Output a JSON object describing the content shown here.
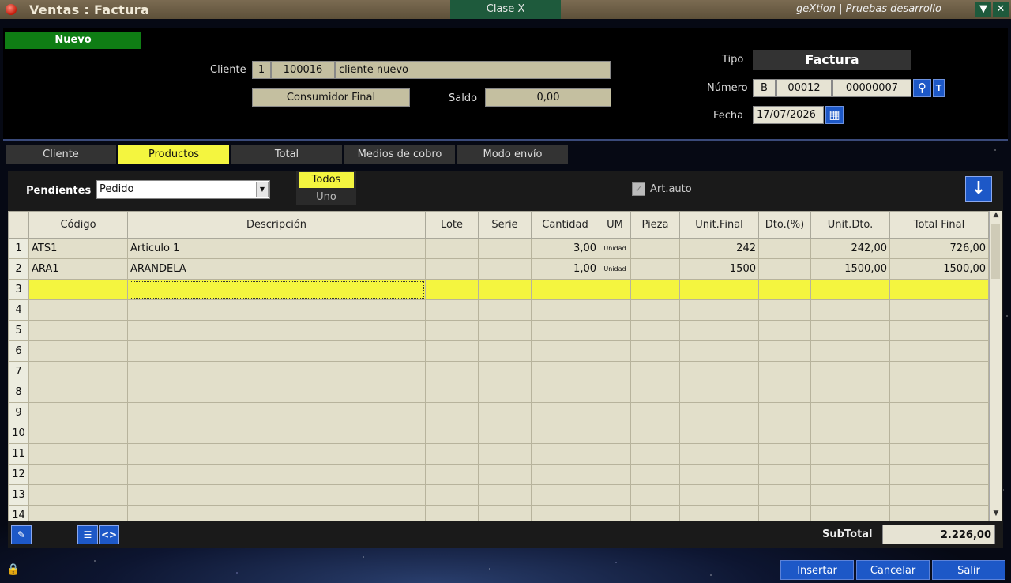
{
  "window": {
    "title": "Ventas : Factura",
    "clase": "Clase X",
    "app_name": "geXtion | Pruebas desarrollo",
    "min_glyph": "▼",
    "close_glyph": "✕"
  },
  "header": {
    "status": "Nuevo",
    "cliente_label": "Cliente",
    "cliente_num": "1",
    "cliente_code": "100016",
    "cliente_name": "cliente nuevo",
    "condicion": "Consumidor Final",
    "saldo_label": "Saldo",
    "saldo_value": "0,00",
    "tipo_label": "Tipo",
    "tipo_value": "Factura",
    "numero_label": "Número",
    "numero_letra": "B",
    "numero_pv": "00012",
    "numero_nro": "00000007",
    "search_glyph": "⚲",
    "t_button": "T",
    "fecha_label": "Fecha",
    "fecha_value": "17/07/2026"
  },
  "tabs": [
    {
      "label": "Cliente",
      "active": false
    },
    {
      "label": "Productos",
      "active": true
    },
    {
      "label": "Total",
      "active": false
    },
    {
      "label": "Medios de cobro",
      "active": false
    },
    {
      "label": "Modo envío",
      "active": false
    }
  ],
  "filters": {
    "pendientes_label": "Pendientes",
    "pendientes_value": "Pedido",
    "todos": "Todos",
    "uno": "Uno",
    "art_auto": "Art.auto",
    "down_glyph": "↓"
  },
  "grid": {
    "columns": [
      "Código",
      "Descripción",
      "Lote",
      "Serie",
      "Cantidad",
      "UM",
      "Pieza",
      "Unit.Final",
      "Dto.(%)",
      "Unit.Dto.",
      "Total Final"
    ],
    "rows": [
      [
        "1",
        "ATS1",
        "Articulo 1",
        "",
        "",
        "3,00",
        "Unidad",
        "",
        "242",
        "",
        "242,00",
        "726,00"
      ],
      [
        "2",
        "ARA1",
        "ARANDELA",
        "",
        "",
        "1,00",
        "Unidad",
        "",
        "1500",
        "",
        "1500,00",
        "1500,00"
      ],
      [
        "3",
        "",
        "",
        "",
        "",
        "",
        "",
        "",
        "",
        "",
        "",
        ""
      ],
      [
        "4",
        "",
        "",
        "",
        "",
        "",
        "",
        "",
        "",
        "",
        "",
        ""
      ],
      [
        "5",
        "",
        "",
        "",
        "",
        "",
        "",
        "",
        "",
        "",
        "",
        ""
      ],
      [
        "6",
        "",
        "",
        "",
        "",
        "",
        "",
        "",
        "",
        "",
        "",
        ""
      ],
      [
        "7",
        "",
        "",
        "",
        "",
        "",
        "",
        "",
        "",
        "",
        "",
        ""
      ],
      [
        "8",
        "",
        "",
        "",
        "",
        "",
        "",
        "",
        "",
        "",
        "",
        ""
      ],
      [
        "9",
        "",
        "",
        "",
        "",
        "",
        "",
        "",
        "",
        "",
        "",
        ""
      ],
      [
        "10",
        "",
        "",
        "",
        "",
        "",
        "",
        "",
        "",
        "",
        "",
        ""
      ],
      [
        "11",
        "",
        "",
        "",
        "",
        "",
        "",
        "",
        "",
        "",
        "",
        ""
      ],
      [
        "12",
        "",
        "",
        "",
        "",
        "",
        "",
        "",
        "",
        "",
        "",
        ""
      ],
      [
        "13",
        "",
        "",
        "",
        "",
        "",
        "",
        "",
        "",
        "",
        "",
        ""
      ],
      [
        "14",
        "",
        "",
        "",
        "",
        "",
        "",
        "",
        "",
        "",
        "",
        ""
      ]
    ],
    "current_row": 3
  },
  "totals": {
    "subtotal_label": "SubTotal",
    "subtotal_value": "2.226,00"
  },
  "icons": {
    "edit_icon": "✎",
    "list_icon": "☰",
    "code_icon": "<>",
    "lock_icon": "🔒",
    "calendar_icon": "▦"
  },
  "actions": {
    "insertar": "Insertar",
    "cancelar": "Cancelar",
    "salir": "Salir"
  },
  "colors": {
    "accent_yellow": "#f4f53f",
    "button_blue": "#1d58c7",
    "status_green": "#0f7d14"
  }
}
